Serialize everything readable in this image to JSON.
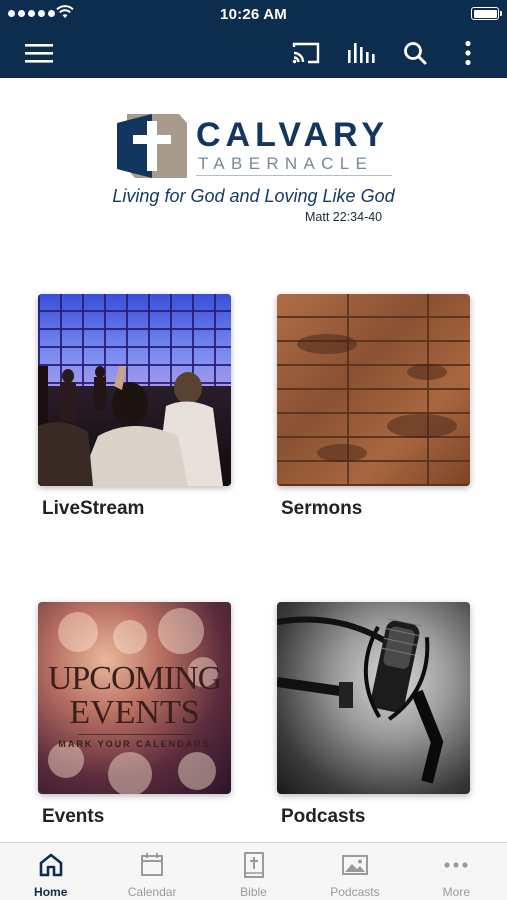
{
  "status_bar": {
    "time": "10:26 AM"
  },
  "app_bar": {
    "icons": [
      "menu-icon",
      "cast-icon",
      "audio-bars-icon",
      "search-icon",
      "more-vertical-icon"
    ],
    "color": "#0c2d4e"
  },
  "logo": {
    "name": "CALVARY",
    "subtitle": "TABERNACLE",
    "tagline": "Living for God and Loving Like God",
    "verse": "Matt 22:34-40",
    "colors": {
      "primary": "#12365e",
      "cross_bg": "#a89b8c"
    }
  },
  "tiles": [
    {
      "label": "LiveStream",
      "icon": "worship-image"
    },
    {
      "label": "Sermons",
      "icon": "wood-texture-image"
    },
    {
      "label": "Events",
      "icon": "upcoming-events-image",
      "art_lines": [
        "UPCOMING",
        "EVENTS",
        "MARK YOUR CALENDARS"
      ]
    },
    {
      "label": "Podcasts",
      "icon": "microphone-image"
    }
  ],
  "tab_bar": {
    "items": [
      {
        "label": "Home",
        "icon": "home-icon",
        "active": true
      },
      {
        "label": "Calendar",
        "icon": "calendar-icon",
        "active": false
      },
      {
        "label": "Bible",
        "icon": "bible-icon",
        "active": false
      },
      {
        "label": "Podcasts",
        "icon": "image-icon",
        "active": false
      },
      {
        "label": "More",
        "icon": "ellipsis-icon",
        "active": false
      }
    ],
    "active_color": "#0c2d4e",
    "inactive_color": "#9a9a9a"
  }
}
